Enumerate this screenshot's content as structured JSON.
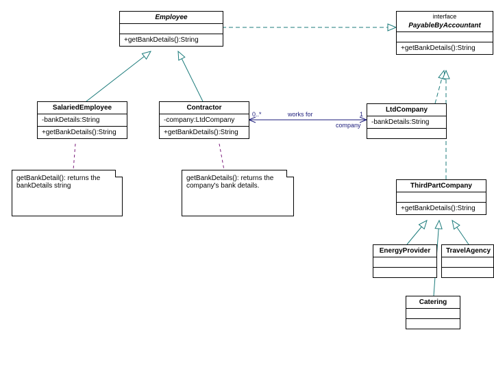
{
  "classes": {
    "employee": {
      "name": "Employee",
      "methods": [
        "+getBankDetails():String"
      ]
    },
    "payableByAccountant": {
      "stereotype": "interface",
      "name": "PayableByAccountant",
      "methods": [
        "+getBankDetails():String"
      ]
    },
    "salariedEmployee": {
      "name": "SalariedEmployee",
      "attrs": [
        "-bankDetails:String"
      ],
      "methods": [
        "+getBankDetails():String"
      ]
    },
    "contractor": {
      "name": "Contractor",
      "attrs": [
        "-company:LtdCompany"
      ],
      "methods": [
        "+getBankDetails():String"
      ]
    },
    "ltdCompany": {
      "name": "LtdCompany",
      "attrs": [
        "-bankDetails:String"
      ]
    },
    "thirdPartCompany": {
      "name": "ThirdPartCompany",
      "methods": [
        "+getBankDetails():String"
      ]
    },
    "energyProvider": {
      "name": "EnergyProvider"
    },
    "travelAgency": {
      "name": "TravelAgency"
    },
    "catering": {
      "name": "Catering"
    }
  },
  "notes": {
    "salariedNote": "getBankDetail(): returns the bankDetails string",
    "contractorNote": "getBankDetails(): returns the company's bank details."
  },
  "assoc": {
    "worksFor": {
      "label": "works for",
      "multLeft": "0..*",
      "multRight": "1",
      "role": "company"
    }
  },
  "colors": {
    "teal": "#1a7a7a",
    "navy": "#1a1a7a",
    "purple": "#7a1a7a"
  }
}
